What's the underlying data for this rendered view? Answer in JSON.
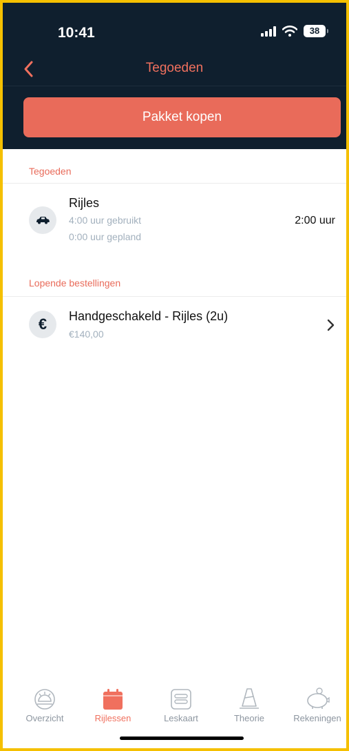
{
  "status_bar": {
    "time": "10:41",
    "battery": "38"
  },
  "nav": {
    "title": "Tegoeden"
  },
  "buy_button": {
    "label": "Pakket kopen"
  },
  "credits": {
    "section_title": "Tegoeden",
    "item": {
      "title": "Rijles",
      "used": "4:00 uur gebruikt",
      "planned": "0:00 uur gepland",
      "remaining": "2:00 uur",
      "icon": "car-icon"
    }
  },
  "orders": {
    "section_title": "Lopende bestellingen",
    "item": {
      "title": "Handgeschakeld - Rijles (2u)",
      "price": "€140,00",
      "icon": "euro-icon"
    }
  },
  "tabbar": {
    "tabs": [
      {
        "label": "Overzicht",
        "icon": "sun-icon",
        "active": false
      },
      {
        "label": "Rijlessen",
        "icon": "calendar-icon",
        "active": true
      },
      {
        "label": "Leskaart",
        "icon": "card-icon",
        "active": false
      },
      {
        "label": "Theorie",
        "icon": "cone-icon",
        "active": false
      },
      {
        "label": "Rekeningen",
        "icon": "piggy-bank-icon",
        "active": false
      }
    ]
  },
  "colors": {
    "accent": "#e96b5a",
    "header": "#0f1f2e",
    "frame": "#f5c000"
  }
}
